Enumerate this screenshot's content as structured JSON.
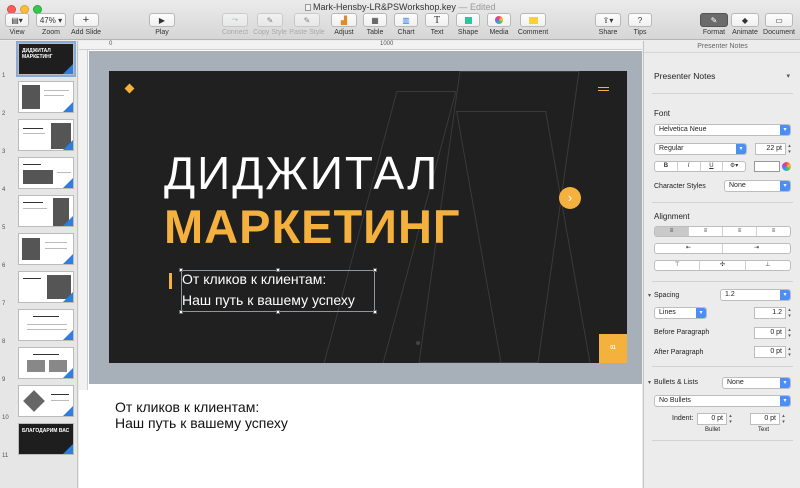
{
  "window": {
    "title": "Mark-Hensby-LR&PSWorkshop.key",
    "status": "Edited"
  },
  "toolbar": {
    "view": "View",
    "zoom_value": "47%",
    "zoom": "Zoom",
    "add_slide": "Add Slide",
    "play": "Play",
    "connect": "Connect",
    "copy_style": "Copy Style",
    "paste_style": "Paste Style",
    "adjust": "Adjust",
    "table": "Table",
    "chart": "Chart",
    "text": "Text",
    "shape": "Shape",
    "media": "Media",
    "comment": "Comment",
    "share": "Share",
    "tips": "Tips",
    "format": "Format",
    "animate": "Animate",
    "document": "Document"
  },
  "navigator": {
    "slides": [
      {
        "num": "1",
        "title": "ДИДЖИТАЛ МАРКЕТИНГ"
      },
      {
        "num": "2"
      },
      {
        "num": "3"
      },
      {
        "num": "4"
      },
      {
        "num": "5"
      },
      {
        "num": "6"
      },
      {
        "num": "7"
      },
      {
        "num": "8"
      },
      {
        "num": "9"
      },
      {
        "num": "10"
      },
      {
        "num": "11",
        "title": "БЛАГОДАРИМ ВАС"
      }
    ]
  },
  "ruler": {
    "top_marks": [
      "0",
      "1000"
    ]
  },
  "slide": {
    "title_line1": "ДИДЖИТАЛ",
    "title_line2": "МАРКЕТИНГ",
    "subtitle_line1": "От кликов к клиентам:",
    "subtitle_line2": "Наш путь к вашему успеху",
    "arrow": "›",
    "page": "01"
  },
  "notes": {
    "line1": "От кликов к клиентам:",
    "line2": "Наш путь к вашему успеху"
  },
  "inspector": {
    "header": "Presenter Notes",
    "style": "Presenter Notes",
    "font_section": "Font",
    "font_family": "Helvetica Neue",
    "font_style": "Regular",
    "font_size": "22 pt",
    "bold": "B",
    "italic": "I",
    "underline": "U",
    "character_styles_label": "Character Styles",
    "character_styles_value": "None",
    "alignment_section": "Alignment",
    "spacing_label": "Spacing",
    "spacing_value": "1.2",
    "lines_value": "Lines",
    "lines_amount": "1.2",
    "before_paragraph_label": "Before Paragraph",
    "before_paragraph_value": "0 pt",
    "after_paragraph_label": "After Paragraph",
    "after_paragraph_value": "0 pt",
    "bullets_label": "Bullets & Lists",
    "bullets_value": "None",
    "no_bullets": "No Bullets",
    "indent_label": "Indent:",
    "indent_bullet_value": "0 pt",
    "indent_text_value": "0 pt",
    "bullet_caption": "Bullet",
    "text_caption": "Text"
  },
  "colors": {
    "accent": "#f5b13d",
    "slide_bg": "#202020",
    "selection": "#4b8ff5"
  }
}
